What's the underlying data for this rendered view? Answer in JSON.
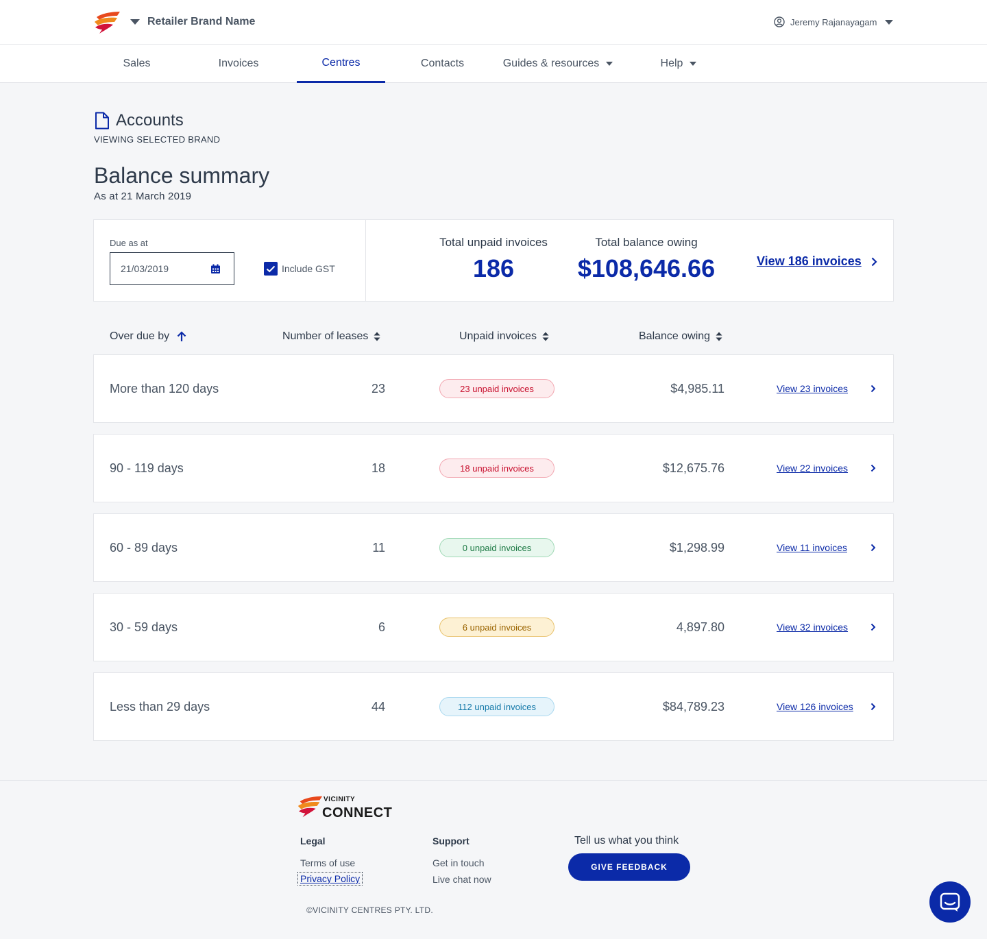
{
  "header": {
    "brand_name": "Retailer Brand Name",
    "user_name": "Jeremy Rajanayagam"
  },
  "nav": {
    "items": [
      {
        "label": "Sales",
        "active": false,
        "dropdown": false
      },
      {
        "label": "Invoices",
        "active": false,
        "dropdown": false
      },
      {
        "label": "Centres",
        "active": true,
        "dropdown": false
      },
      {
        "label": "Contacts",
        "active": false,
        "dropdown": false
      },
      {
        "label": "Guides & resources",
        "active": false,
        "dropdown": true
      },
      {
        "label": "Help",
        "active": false,
        "dropdown": true
      }
    ]
  },
  "page": {
    "section_title": "Accounts",
    "section_subtitle": "VIEWING SELECTED BRAND",
    "title": "Balance summary",
    "subtitle": "As at 21 March 2019"
  },
  "summary": {
    "due_label": "Due as at",
    "date_value": "21/03/2019",
    "include_gst_label": "Include GST",
    "include_gst_checked": true,
    "unpaid_label": "Total unpaid invoices",
    "unpaid_value": "186",
    "balance_label": "Total balance owing",
    "balance_value": "$108,646.66",
    "view_all_label": "View 186 invoices"
  },
  "table": {
    "headers": {
      "overdue": "Over due by",
      "leases": "Number of leases",
      "unpaid": "Unpaid invoices",
      "balance": "Balance owing"
    },
    "rows": [
      {
        "period": "More than 120 days",
        "leases": "23",
        "badge": "23 unpaid invoices",
        "badge_color": "red",
        "balance": "$4,985.11",
        "link": "View 23 invoices"
      },
      {
        "period": "90 - 119 days",
        "leases": "18",
        "badge": "18 unpaid invoices",
        "badge_color": "red",
        "balance": "$12,675.76",
        "link": "View 22 invoices"
      },
      {
        "period": "60 - 89 days",
        "leases": "11",
        "badge": "0 unpaid invoices",
        "badge_color": "green",
        "balance": "$1,298.99",
        "link": "View 11 invoices"
      },
      {
        "period": "30 - 59 days",
        "leases": "6",
        "badge": "6 unpaid invoices",
        "badge_color": "yellow",
        "balance": "4,897.80",
        "link": "View 32 invoices"
      },
      {
        "period": "Less than 29 days",
        "leases": "44",
        "badge": "112 unpaid invoices",
        "badge_color": "blue",
        "balance": "$84,789.23",
        "link": "View 126 invoices"
      }
    ]
  },
  "footer": {
    "logo_small": "VICINITY",
    "logo_large": "CONNECT",
    "legal_heading": "Legal",
    "terms": "Terms of use",
    "privacy": "Privacy Policy",
    "support_heading": "Support",
    "get_in_touch": "Get in touch",
    "live_chat": "Live chat now",
    "feedback_prompt": "Tell us what you think",
    "feedback_button": "GIVE FEEDBACK",
    "copyright": "©VICINITY CENTRES PTY. LTD."
  },
  "colors": {
    "primary": "#0b2aa8",
    "text": "#2e3a4a",
    "background": "#f5f6f8"
  }
}
